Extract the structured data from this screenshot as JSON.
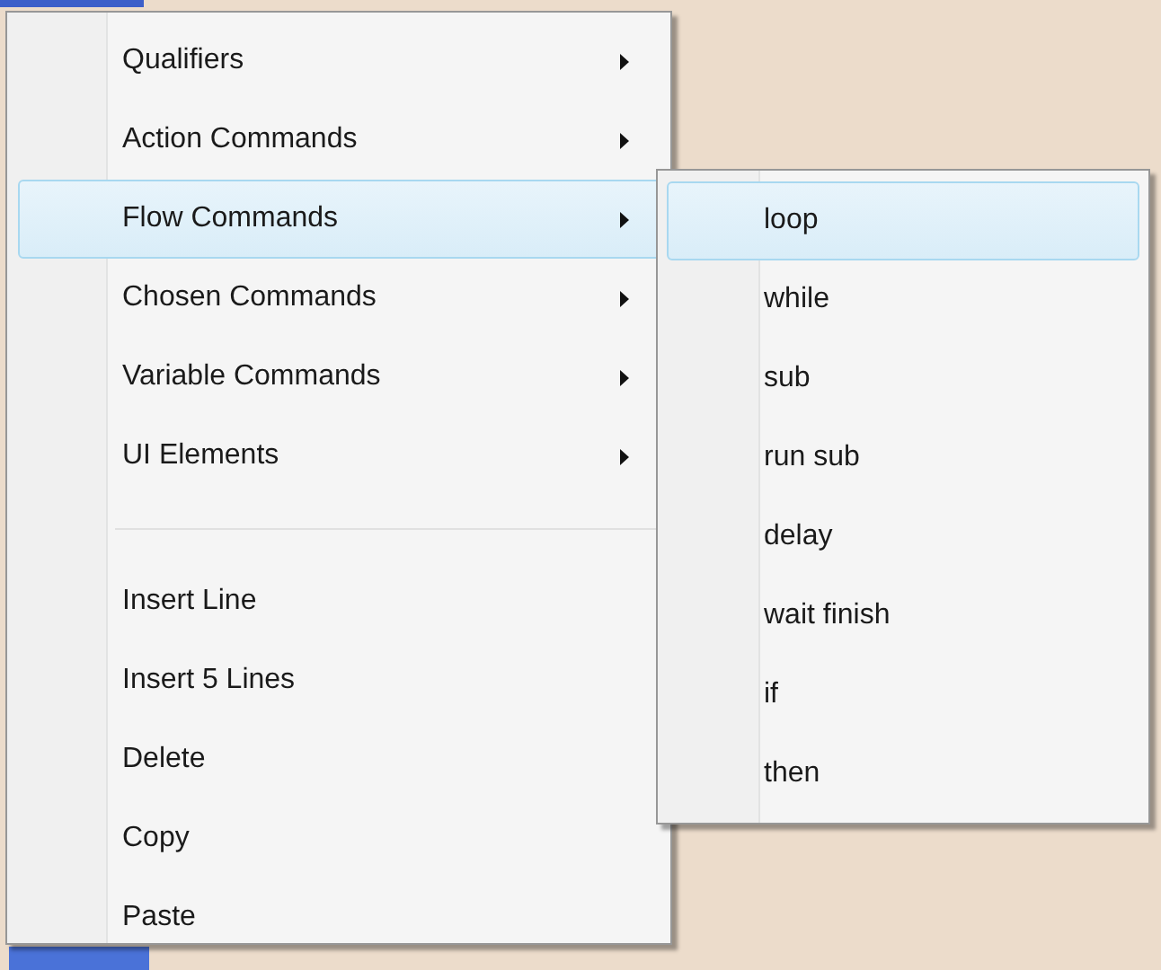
{
  "context_menu": {
    "items": [
      {
        "kind": "submenu",
        "label": "Qualifiers",
        "selected": false
      },
      {
        "kind": "submenu",
        "label": "Action Commands",
        "selected": false
      },
      {
        "kind": "submenu",
        "label": "Flow Commands",
        "selected": true
      },
      {
        "kind": "submenu",
        "label": "Chosen Commands",
        "selected": false
      },
      {
        "kind": "submenu",
        "label": "Variable Commands",
        "selected": false
      },
      {
        "kind": "submenu",
        "label": "UI Elements",
        "selected": false
      },
      {
        "kind": "separator"
      },
      {
        "kind": "command",
        "label": "Insert Line",
        "selected": false
      },
      {
        "kind": "command",
        "label": "Insert 5 Lines",
        "selected": false
      },
      {
        "kind": "command",
        "label": "Delete",
        "selected": false
      },
      {
        "kind": "command",
        "label": "Copy",
        "selected": false
      },
      {
        "kind": "command",
        "label": "Paste",
        "selected": false
      }
    ]
  },
  "submenu": {
    "items": [
      {
        "label": "loop",
        "selected": true
      },
      {
        "label": "while",
        "selected": false
      },
      {
        "label": "sub",
        "selected": false
      },
      {
        "label": "run sub",
        "selected": false
      },
      {
        "label": "delay",
        "selected": false
      },
      {
        "label": "wait finish",
        "selected": false
      },
      {
        "label": "if",
        "selected": false
      },
      {
        "label": "then",
        "selected": false
      }
    ]
  }
}
